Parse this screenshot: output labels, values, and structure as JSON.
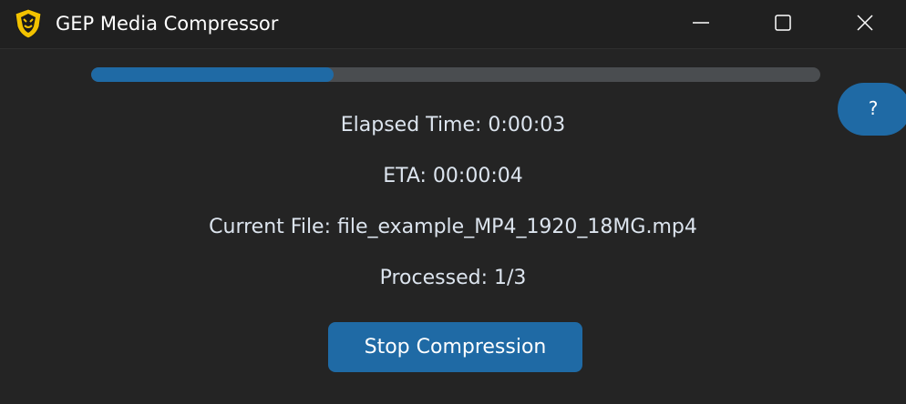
{
  "window": {
    "title": "GEP Media Compressor",
    "icon": "shield-lion-logo-icon",
    "controls": {
      "minimize_icon": "minimize-icon",
      "maximize_icon": "maximize-icon",
      "close_icon": "close-icon"
    }
  },
  "progress": {
    "fraction": 0.333,
    "fill_color": "#1f6aa5",
    "track_color": "#4a4d50"
  },
  "help_button": {
    "label": "?"
  },
  "status": {
    "elapsed": "Elapsed Time: 0:00:03",
    "eta": "ETA: 00:00:04",
    "current_file": "Current File: file_example_MP4_1920_18MG.mp4",
    "processed": "Processed: 1/3"
  },
  "actions": {
    "stop_label": "Stop Compression"
  },
  "colors": {
    "background": "#242424",
    "accent": "#1f6aa5",
    "text": "#dce4ee"
  }
}
